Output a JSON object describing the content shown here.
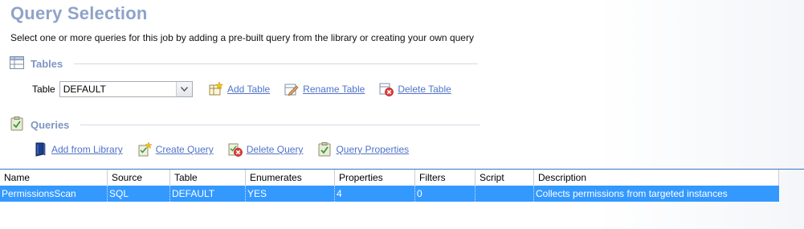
{
  "header": {
    "title": "Query Selection",
    "subtitle": "Select one or more queries for this job by adding a pre-built query from the library or creating your own query"
  },
  "tables_section": {
    "label": "Tables",
    "icon": "table-grid-icon",
    "table_label": "Table",
    "table_value": "DEFAULT",
    "actions": [
      {
        "label": "Add Table",
        "icon": "add-table-icon"
      },
      {
        "label": "Rename Table",
        "icon": "rename-table-icon"
      },
      {
        "label": "Delete Table",
        "icon": "delete-table-icon"
      }
    ]
  },
  "queries_section": {
    "label": "Queries",
    "icon": "clipboard-check-icon",
    "actions": [
      {
        "label": "Add from Library",
        "icon": "book-icon"
      },
      {
        "label": "Create Query",
        "icon": "create-query-icon"
      },
      {
        "label": "Delete Query",
        "icon": "delete-query-icon"
      },
      {
        "label": "Query Properties",
        "icon": "query-properties-icon"
      }
    ]
  },
  "grid": {
    "columns": [
      "Name",
      "Source",
      "Table",
      "Enumerates",
      "Properties",
      "Filters",
      "Script",
      "Description"
    ],
    "rows": [
      [
        "PermissionsScan",
        "SQL",
        "DEFAULT",
        "YES",
        "4",
        "0",
        "",
        "Collects permissions from targeted instances"
      ]
    ],
    "selected_row_color": "#3399ff"
  },
  "colors": {
    "title": "#8fa3c8",
    "section_label": "#7e96c3",
    "link": "#4f73c9"
  }
}
